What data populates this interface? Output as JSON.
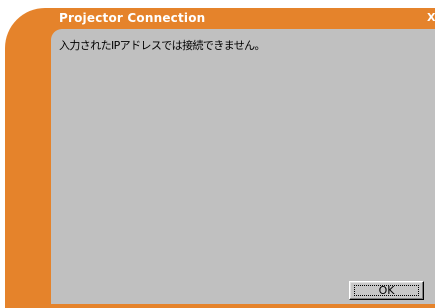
{
  "window": {
    "title": "Projector Connection",
    "close_label": "X"
  },
  "dialog": {
    "message": "入力されたIPアドレスでは接続できません。",
    "ok_label": "OK"
  },
  "colors": {
    "frame": "#e5832b",
    "content": "#c0c0c0",
    "title_text": "#ffffff"
  }
}
